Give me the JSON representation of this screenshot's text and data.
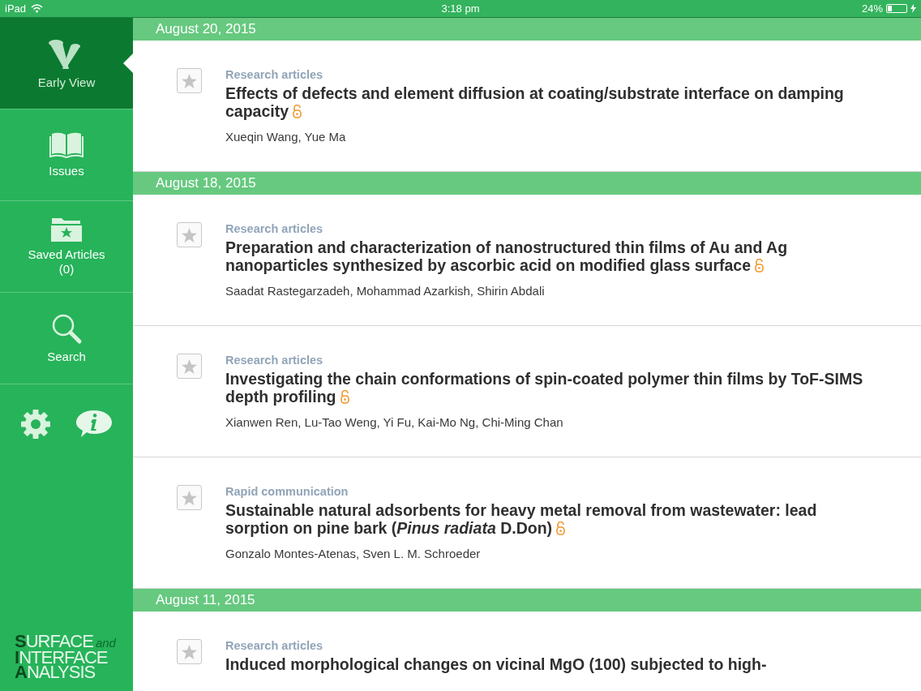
{
  "status_bar": {
    "device": "iPad",
    "time": "3:18 pm",
    "battery": "24%"
  },
  "sidebar": {
    "items": [
      {
        "kind": "early_view",
        "label": "Early View",
        "selected": true
      },
      {
        "kind": "issues",
        "label": "Issues",
        "selected": false
      },
      {
        "kind": "saved",
        "label": "Saved Articles",
        "count": "(0)",
        "selected": false
      },
      {
        "kind": "search",
        "label": "Search",
        "selected": false
      }
    ],
    "logo": [
      {
        "initial": "S",
        "rest": "URFACE",
        "suffix": "and"
      },
      {
        "initial": "I",
        "rest": "NTERFACE"
      },
      {
        "initial": "A",
        "rest": "NALYSIS"
      }
    ]
  },
  "sections": [
    {
      "date": "August 20, 2015",
      "articles": [
        {
          "category": "Research articles",
          "title": "Effects of defects and element diffusion at coating/substrate interface on damping capacity",
          "open_access": true,
          "authors": "Xueqin Wang, Yue Ma"
        }
      ]
    },
    {
      "date": "August 18, 2015",
      "articles": [
        {
          "category": "Research articles",
          "title": "Preparation and characterization of nanostructured thin films of Au and Ag nanoparticles synthesized by ascorbic acid on modified glass surface",
          "open_access": true,
          "authors": "Saadat Rastegarzadeh, Mohammad Azarkish, Shirin Abdali"
        },
        {
          "category": "Research articles",
          "title": "Investigating the chain conformations of spin-coated polymer thin films by ToF-SIMS depth profiling",
          "open_access": true,
          "authors": "Xianwen Ren, Lu-Tao Weng, Yi Fu, Kai-Mo Ng, Chi-Ming Chan"
        },
        {
          "category": "Rapid communication",
          "title": "Sustainable natural adsorbents for heavy metal removal from wastewater: lead sorption on pine bark (*Pinus radiata* D.Don)",
          "open_access": true,
          "authors": "Gonzalo Montes-Atenas, Sven L. M. Schroeder"
        }
      ]
    },
    {
      "date": "August 11, 2015",
      "articles": [
        {
          "category": "Research articles",
          "title": "Induced morphological changes on vicinal MgO (100) subjected to high-",
          "open_access": false
        }
      ]
    }
  ]
}
